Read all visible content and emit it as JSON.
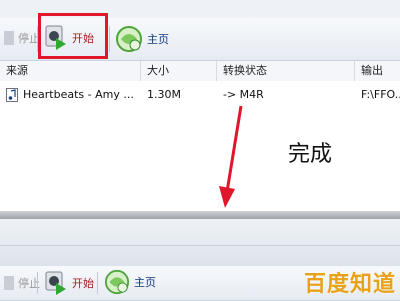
{
  "toolbar": {
    "stop_label": "停止",
    "start_label": "开始",
    "home_label": "主页",
    "icons": {
      "stop": "stop-icon",
      "start": "start-play-icon",
      "home": "home-globe-icon"
    }
  },
  "file_list": {
    "columns": [
      "来源",
      "大小",
      "转换状态",
      "输出 [F2"
    ],
    "rows": [
      {
        "source": "Heartbeats - Amy ...",
        "size": "1.30M",
        "status": "-> M4R",
        "output": "F:\\FFO..."
      }
    ]
  },
  "annotation": {
    "text": "完成",
    "color": "#e0162b"
  },
  "bottom_toolbar": {
    "stop_label": "停止",
    "start_label": "开始",
    "home_label": "主页"
  },
  "watermark": {
    "text": "百度知道"
  },
  "colors": {
    "highlight": "#e0162b",
    "start_text": "#a32020",
    "watermark": "#e8a21a"
  }
}
